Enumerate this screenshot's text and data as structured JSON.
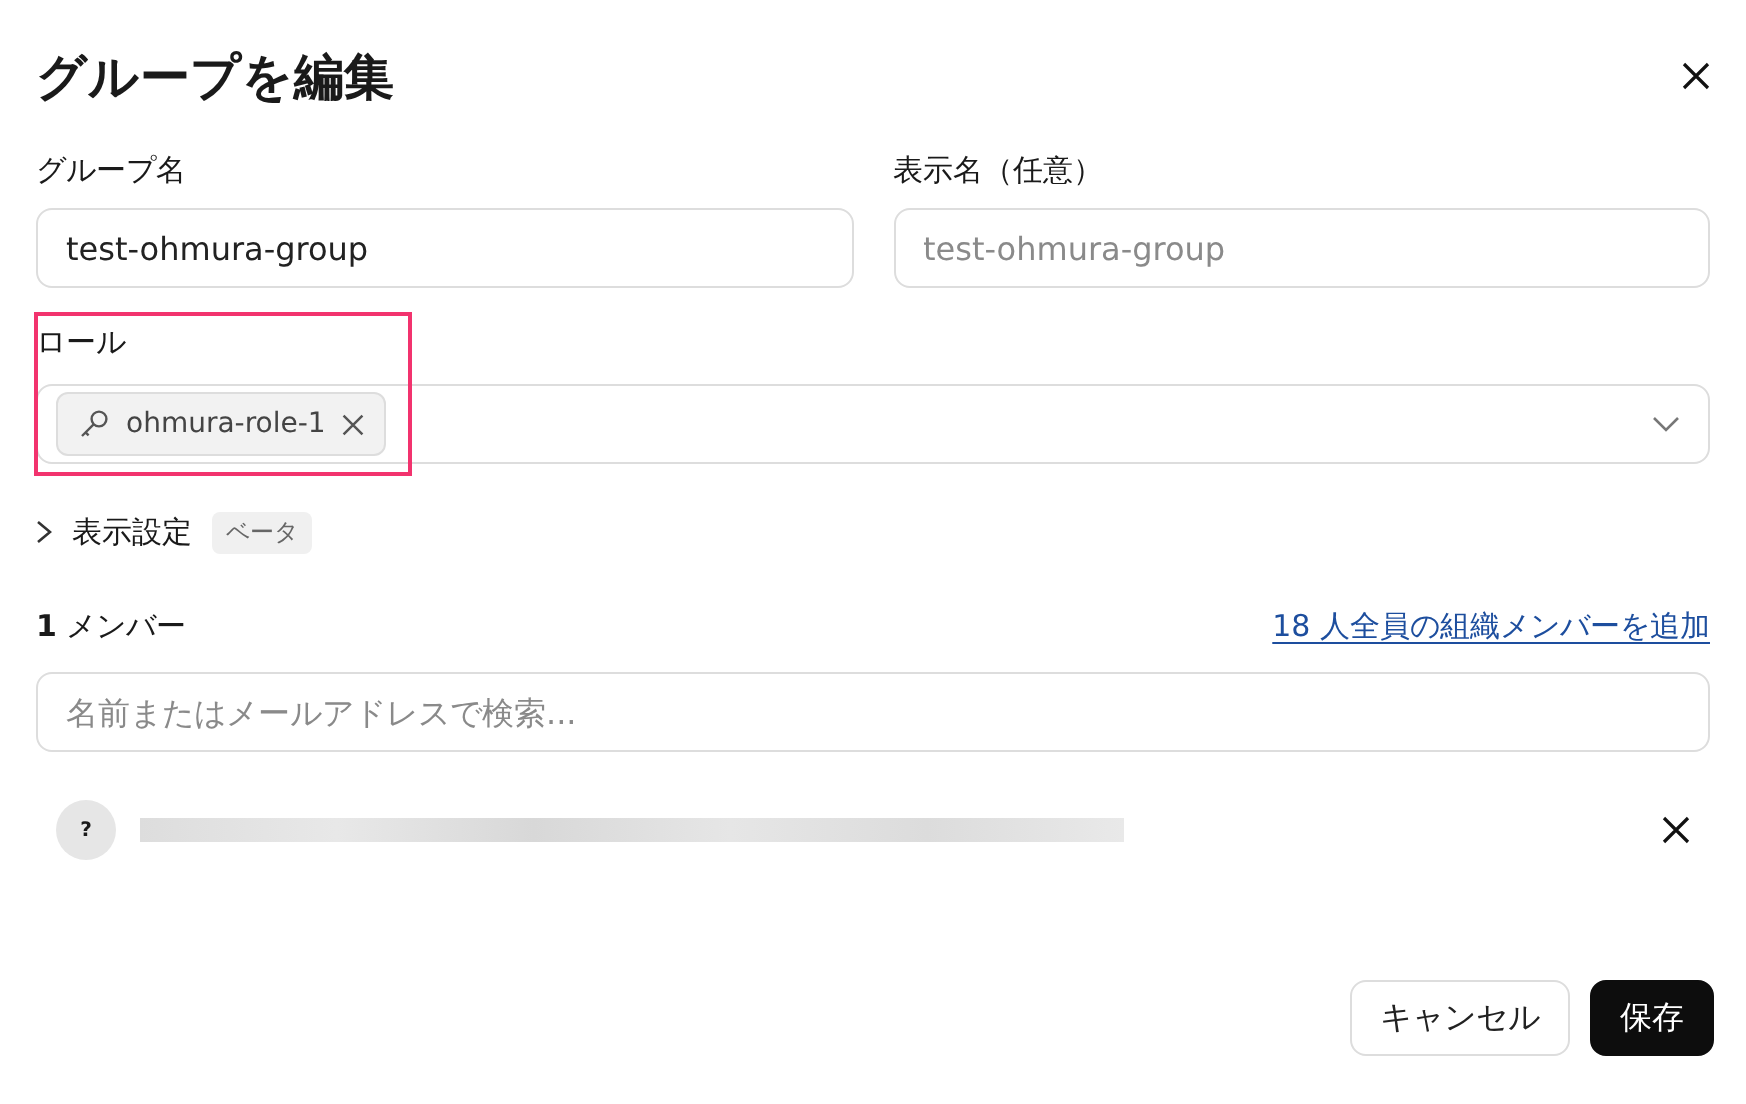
{
  "dialog": {
    "title": "グループを編集"
  },
  "fields": [
    {
      "label": "グループ名",
      "value": "test-ohmura-group"
    },
    {
      "label": "表示名（任意）",
      "placeholder": "test-ohmura-group"
    }
  ],
  "role": {
    "label": "ロール",
    "highlighted": true,
    "chips": [
      {
        "label": "ohmura-role-1"
      }
    ]
  },
  "display_settings": {
    "label": "表示設定",
    "badge": "ベータ",
    "expanded": false
  },
  "members": {
    "heading": "**1** メンバー",
    "add_all_link": "18 人全員の組織メンバーを追加",
    "search": {
      "placeholder": "名前またはメールアドレスで検索..."
    },
    "list": [
      {
        "avatar": "?"
      }
    ]
  },
  "buttons": [
    {
      "label": "キャンセル",
      "kind": "secondary"
    },
    {
      "label": "保存",
      "kind": "primary"
    }
  ]
}
